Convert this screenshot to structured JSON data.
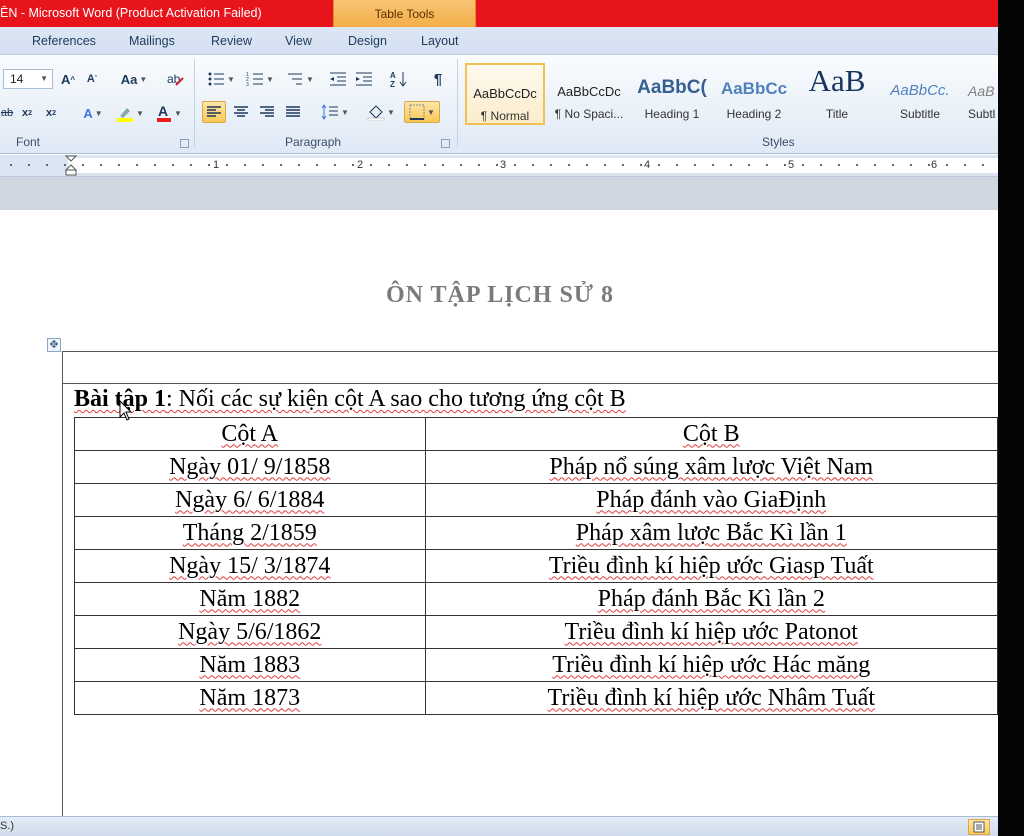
{
  "window": {
    "title": "ÊN  -  Microsoft Word (Product Activation Failed)",
    "context_tab": "Table Tools"
  },
  "ribbon_tabs": [
    "References",
    "Mailings",
    "Review",
    "View",
    "Design",
    "Layout"
  ],
  "font_group": {
    "label": "Font",
    "font_size": "14",
    "aa_label": "Aa"
  },
  "paragraph_group": {
    "label": "Paragraph"
  },
  "styles_group": {
    "label": "Styles",
    "items": [
      {
        "preview": "AaBbCcDc",
        "name": "¶ Normal"
      },
      {
        "preview": "AaBbCcDc",
        "name": "¶ No Spaci..."
      },
      {
        "preview": "AaBbC(",
        "name": "Heading 1"
      },
      {
        "preview": "AaBbCc",
        "name": "Heading 2"
      },
      {
        "preview": "AaB",
        "name": "Title"
      },
      {
        "preview": "AaBbCc.",
        "name": "Subtitle"
      },
      {
        "preview": "AaB",
        "name": "Subtl"
      }
    ]
  },
  "ruler": {
    "numbers": [
      "1",
      "2",
      "3",
      "4",
      "5",
      "6"
    ]
  },
  "document": {
    "heading": "ÔN TẬP LỊCH SỬ 8",
    "exercise_label": "Bài tập 1",
    "exercise_text": ": Nối các sự kiện cột A sao cho tương ứng cột B",
    "table": {
      "headers": [
        "Cột A",
        "Cột B"
      ],
      "rows": [
        [
          "Ngày 01/ 9/1858",
          "Pháp nổ súng xâm lược Việt Nam"
        ],
        [
          "Ngày 6/ 6/1884",
          "Pháp đánh vào GiaĐịnh"
        ],
        [
          "Tháng 2/1859",
          "Pháp xâm lược Bắc Kì lần 1"
        ],
        [
          "Ngày 15/ 3/1874",
          "Triều đình kí hiệp ước Giasp Tuất"
        ],
        [
          "Năm 1882",
          "Pháp đánh Bắc Kì lần 2"
        ],
        [
          "Ngày 5/6/1862",
          "Triều đình kí hiệp ước Patonot"
        ],
        [
          "Năm 1883",
          "Triều đình kí hiệp ước Hác măng"
        ],
        [
          "Năm 1873",
          "Triều đình kí hiệp ước Nhâm Tuất"
        ]
      ]
    }
  },
  "status_bar": {
    "text": "S.)"
  }
}
